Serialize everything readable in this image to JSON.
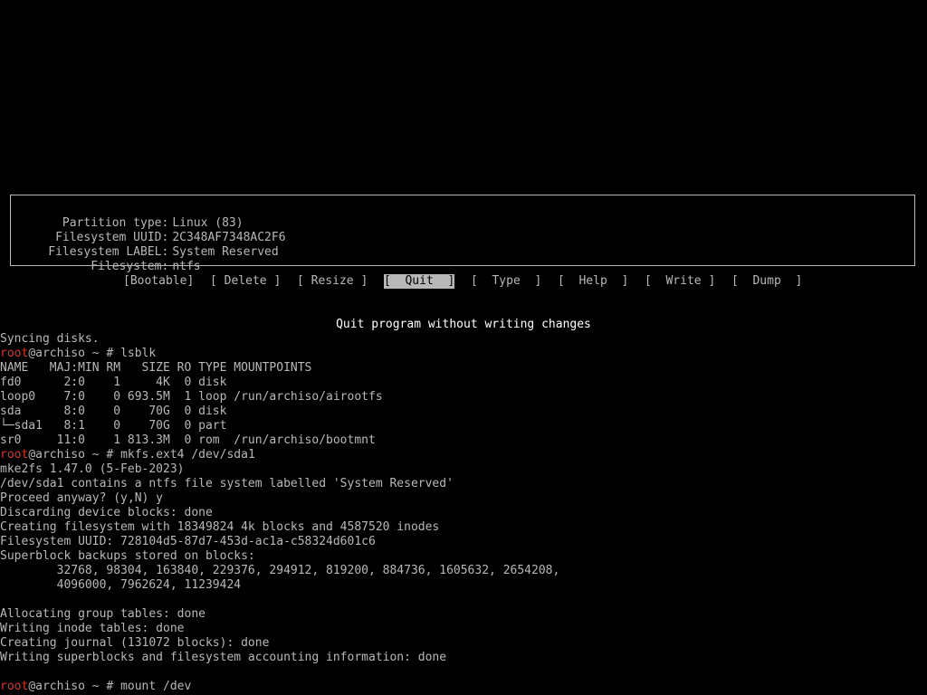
{
  "partition_info": {
    "rows": [
      {
        "key": "Partition type:",
        "value": "Linux (83)"
      },
      {
        "key": "Filesystem UUID:",
        "value": "2C348AF7348AC2F6"
      },
      {
        "key": "Filesystem LABEL:",
        "value": "System Reserved"
      },
      {
        "key": "Filesystem:",
        "value": "ntfs"
      }
    ]
  },
  "menu": {
    "items": [
      {
        "label": "[Bootable]"
      },
      {
        "label": "[ Delete ]"
      },
      {
        "label": "[ Resize ]"
      },
      {
        "label": "[  Quit  ]"
      },
      {
        "label": "[  Type  ]"
      },
      {
        "label": "[  Help  ]"
      },
      {
        "label": "[  Write ]"
      },
      {
        "label": "[  Dump  ]"
      }
    ],
    "selected": "[  Quit  ]",
    "hint": "Quit program without writing changes"
  },
  "terminal": {
    "prompt_user": "root",
    "prompt_rest": "@archiso ~ # ",
    "lines": [
      {
        "text": "Syncing disks."
      },
      {
        "prompt": true,
        "cmd": "lsblk"
      },
      {
        "text": "NAME   MAJ:MIN RM   SIZE RO TYPE MOUNTPOINTS"
      },
      {
        "text": "fd0      2:0    1     4K  0 disk"
      },
      {
        "text": "loop0    7:0    0 693.5M  1 loop /run/archiso/airootfs"
      },
      {
        "text": "sda      8:0    0    70G  0 disk"
      },
      {
        "text": "└─sda1   8:1    0    70G  0 part"
      },
      {
        "text": "sr0     11:0    1 813.3M  0 rom  /run/archiso/bootmnt"
      },
      {
        "prompt": true,
        "cmd": "mkfs.ext4 /dev/sda1"
      },
      {
        "text": "mke2fs 1.47.0 (5-Feb-2023)"
      },
      {
        "text": "/dev/sda1 contains a ntfs file system labelled 'System Reserved'"
      },
      {
        "text": "Proceed anyway? (y,N) y"
      },
      {
        "text": "Discarding device blocks: done"
      },
      {
        "text": "Creating filesystem with 18349824 4k blocks and 4587520 inodes"
      },
      {
        "text": "Filesystem UUID: 728104d5-87d7-453d-ac1a-c58324d601c6"
      },
      {
        "text": "Superblock backups stored on blocks:"
      },
      {
        "text": "        32768, 98304, 163840, 229376, 294912, 819200, 884736, 1605632, 2654208,"
      },
      {
        "text": "        4096000, 7962624, 11239424"
      },
      {
        "text": ""
      },
      {
        "text": "Allocating group tables: done"
      },
      {
        "text": "Writing inode tables: done"
      },
      {
        "text": "Creating journal (131072 blocks): done"
      },
      {
        "text": "Writing superblocks and filesystem accounting information: done"
      },
      {
        "text": ""
      },
      {
        "prompt": true,
        "cmd": "mount /dev"
      }
    ]
  }
}
